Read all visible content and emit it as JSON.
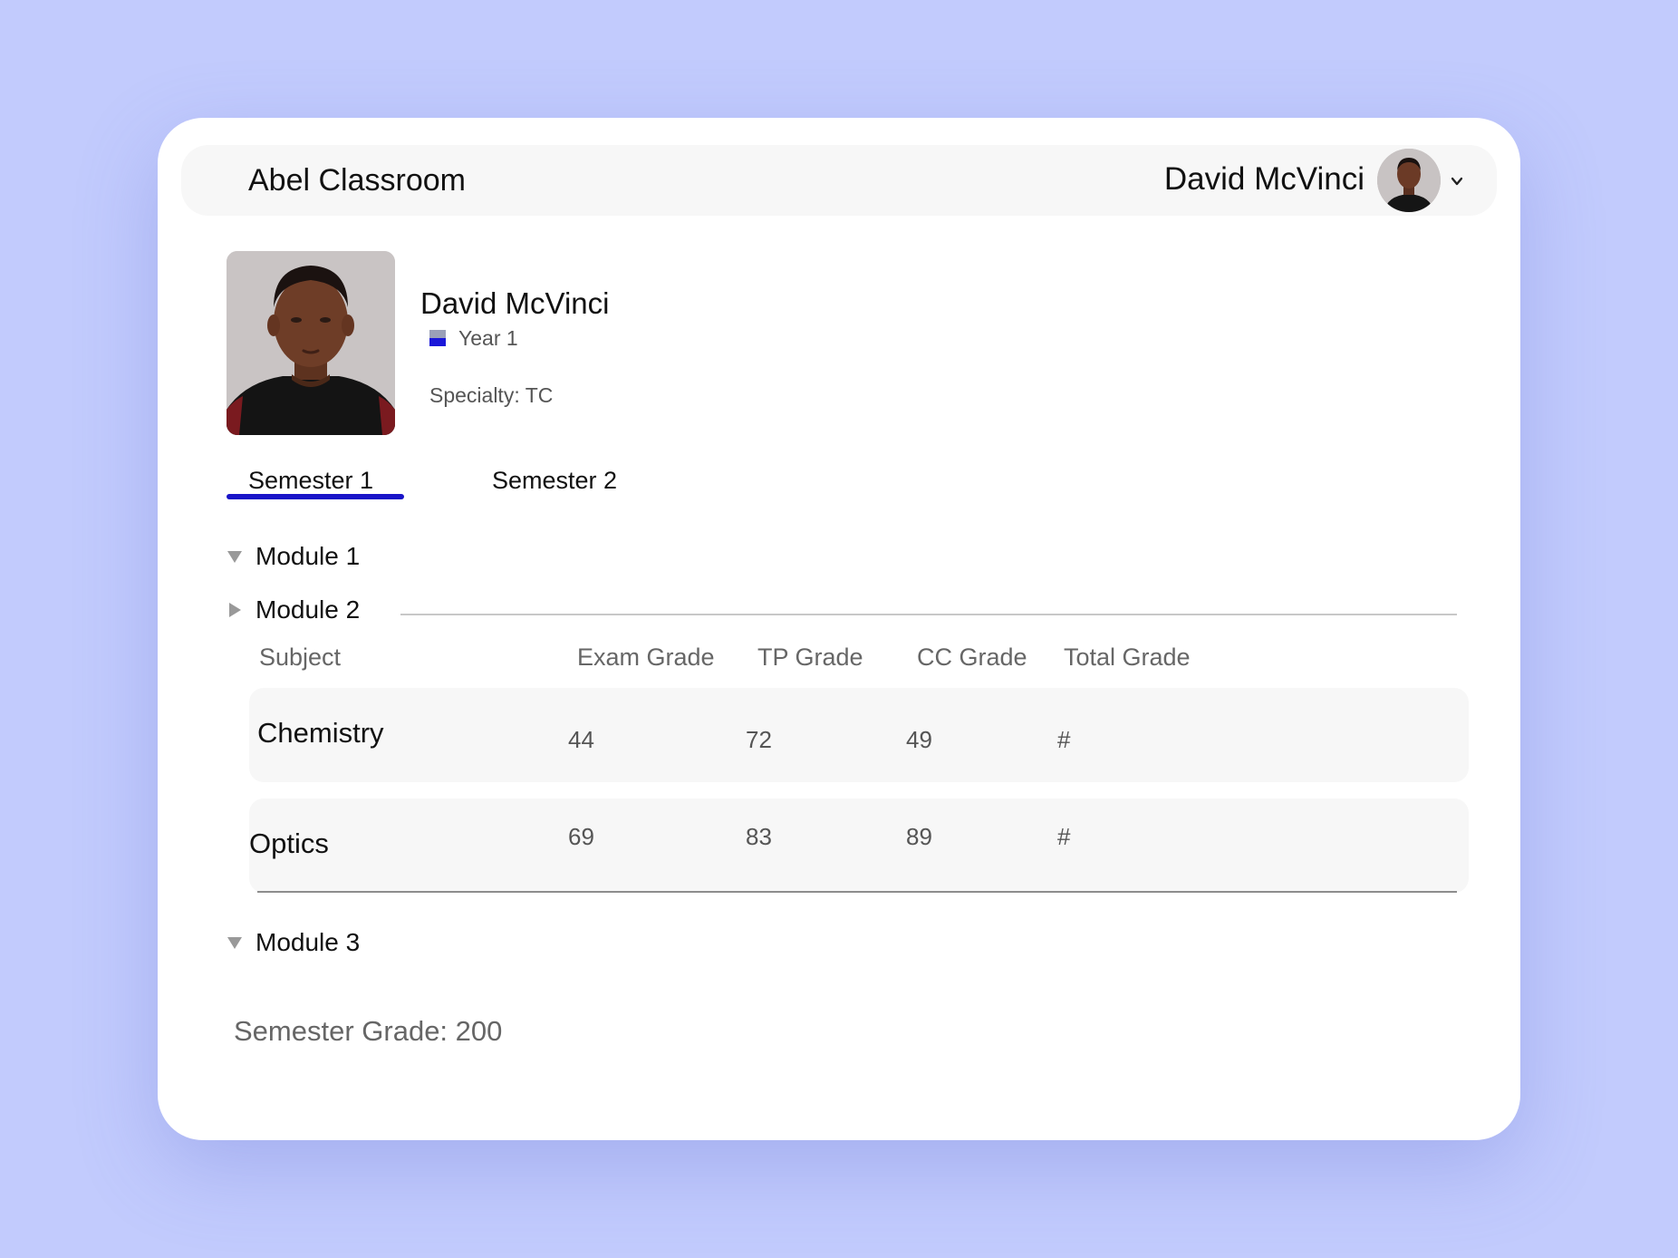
{
  "header": {
    "app_title": "Abel Classroom",
    "user_name": "David McVinci",
    "avatar_icon": "user-avatar",
    "menu_icon": "chevron-down-icon"
  },
  "profile": {
    "name": "David McVinci",
    "year": "Year 1",
    "year_icon": "flag-icon",
    "specialty": "Specialty: TC",
    "photo": "student-photo"
  },
  "tabs": [
    {
      "label": "Semester 1",
      "active": true
    },
    {
      "label": "Semester 2",
      "active": false
    }
  ],
  "modules": [
    {
      "label": "Module 1",
      "expanded": true
    },
    {
      "label": "Module 2",
      "expanded": false
    },
    {
      "label": "Module 3",
      "expanded": true
    }
  ],
  "table": {
    "headers": [
      "Subject",
      "Exam Grade",
      "TP Grade",
      "CC Grade",
      "Total Grade"
    ],
    "rows": [
      {
        "subject": "Chemistry",
        "exam": "44",
        "tp": "72",
        "cc": "49",
        "total": "#"
      },
      {
        "subject": "Optics",
        "exam": "69",
        "tp": "83",
        "cc": "89",
        "total": "#"
      }
    ]
  },
  "footer": {
    "semester_grade": "Semester Grade: 200"
  },
  "colors": {
    "background": "#c2cbfd",
    "card": "#ffffff",
    "accent": "#1914c8",
    "row_background": "#f7f7f7"
  }
}
